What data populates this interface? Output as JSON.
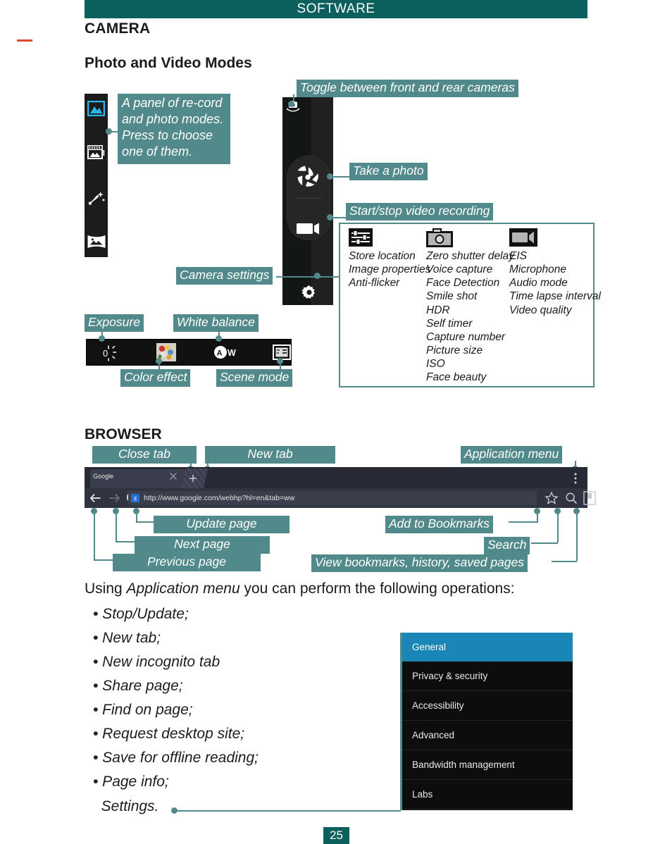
{
  "header": {
    "title": "SOFTWARE"
  },
  "page_number": "25",
  "colors": {
    "header_teal": "#0b5f5c",
    "callout_teal": "#52898a",
    "menu_selected_blue": "#1a86b8",
    "mode_active_blue": "#29b6e8"
  },
  "camera": {
    "section_title": "CAMERA",
    "subsection_title": "Photo and Video Modes",
    "callouts": {
      "mode_panel": "A panel of re-cord and photo modes. Press to choose one of them.",
      "toggle_cameras": "Toggle between front and rear cameras",
      "take_photo": "Take a photo",
      "video_record": "Start/stop video recording",
      "camera_settings": "Camera settings",
      "exposure": "Exposure",
      "white_balance": "White balance",
      "color_effect": "Color effect",
      "scene_mode": "Scene mode"
    },
    "mode_icons": [
      "photo-mode-icon",
      "video-mode-icon",
      "effects-mode-icon",
      "panorama-mode-icon"
    ],
    "exposure_value": "0",
    "white_balance_value": "AW",
    "settings_columns": [
      {
        "icon": "sliders-icon",
        "items": [
          "Store location",
          "Image properties",
          "Anti-flicker"
        ]
      },
      {
        "icon": "camera-icon",
        "items": [
          "Zero shutter delay",
          "Voice capture",
          "Face Detection",
          "Smile shot",
          "HDR",
          "Self timer",
          "Capture number",
          "Picture size",
          "ISO",
          "Face beauty"
        ]
      },
      {
        "icon": "video-camera-icon",
        "items": [
          "EIS",
          "Microphone",
          "Audio mode",
          "Time lapse interval",
          "Video quality"
        ]
      }
    ]
  },
  "browser": {
    "section_title": "BROWSER",
    "tab_label": "Google",
    "url": "http://www.google.com/webhp?hl=en&tab=ww",
    "favicon_letter": "g",
    "callouts": {
      "close_tab": "Close tab",
      "new_tab": "New tab",
      "application_menu": "Application menu",
      "update_page": "Update page",
      "next_page": "Next page",
      "previous_page": "Previous page",
      "add_bookmarks": "Add to Bookmarks",
      "search": "Search",
      "view_bookmarks": "View bookmarks, history, saved  pages"
    },
    "intro_before": "Using ",
    "intro_italic": "Application menu",
    "intro_after": " you can perform the following operations:",
    "menu_operations": [
      "• Stop/Update;",
      "• New tab;",
      "• New incognito tab",
      "• Share page;",
      "• Find on page;",
      "• Request desktop site;",
      "• Save for offline reading;",
      "• Page info;",
      "  Settings."
    ],
    "settings_menu": [
      {
        "label": "General",
        "selected": true
      },
      {
        "label": "Privacy & security",
        "selected": false
      },
      {
        "label": "Accessibility",
        "selected": false
      },
      {
        "label": "Advanced",
        "selected": false
      },
      {
        "label": "Bandwidth management",
        "selected": false
      },
      {
        "label": "Labs",
        "selected": false
      }
    ]
  }
}
